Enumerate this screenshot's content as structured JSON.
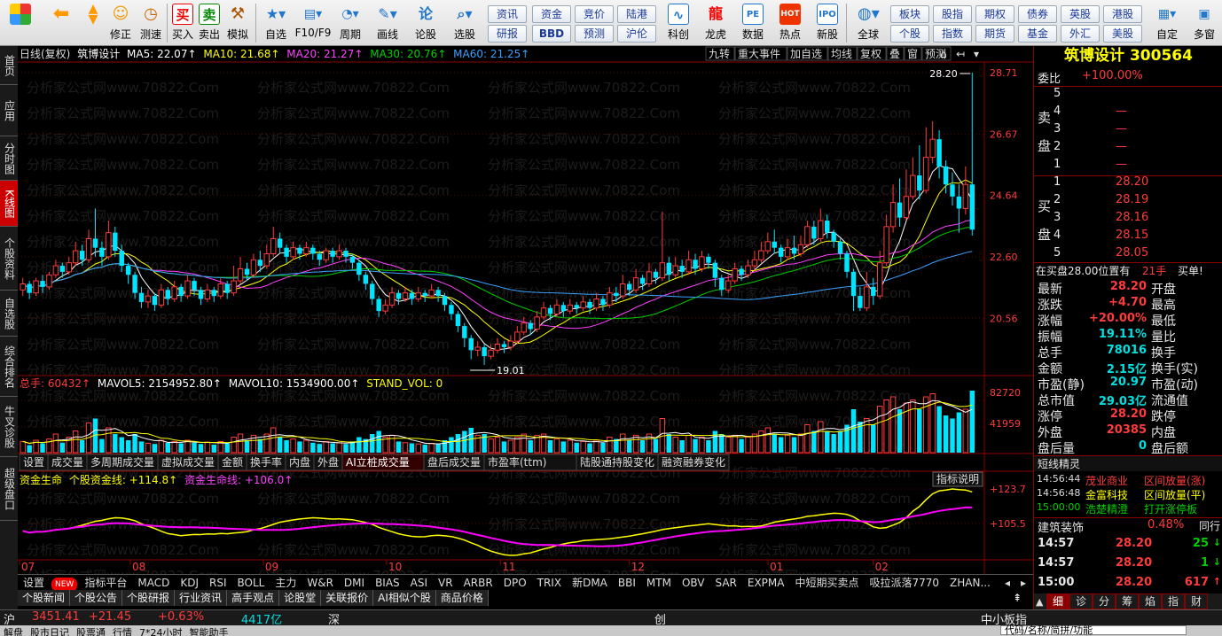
{
  "toolbar": {
    "buttons": [
      "",
      "",
      "修正",
      "测速",
      "买入",
      "卖出",
      "模拟",
      "自选",
      "F10/F9",
      "周期",
      "画线",
      "论股",
      "选股",
      "资讯",
      "资金",
      "竞价",
      "陆港",
      "研报",
      "BBD",
      "预测",
      "沪伦",
      "科创",
      "龙虎",
      "数据",
      "热点",
      "新股",
      "全球",
      "板块",
      "个股",
      "股指",
      "期权",
      "期货",
      "债券",
      "基金",
      "英股",
      "外汇",
      "港股",
      "美股",
      "自定",
      "多窗"
    ],
    "icon_names": [
      "window-icon",
      "back-icon",
      "up-down-icon",
      "smile-icon",
      "clock-icon",
      "buy-icon",
      "sell-icon",
      "hammer-icon",
      "star-icon",
      "f10-icon",
      "period-icon",
      "pen-icon",
      "chat-icon",
      "search-chart-icon",
      "globe-icon",
      "kechuang-icon",
      "dragon-icon",
      "pe-icon",
      "hot-icon",
      "ipo-icon"
    ]
  },
  "sidebar": [
    "首页",
    "应用",
    "分时图",
    "K线图",
    "个股资料",
    "自选股",
    "综合排名",
    "牛叉诊股",
    "超级盘口"
  ],
  "chart": {
    "header": {
      "title": "日线(复权)",
      "name": "筑博设计",
      "ma5": "MA5: 22.07↑",
      "ma10": "MA10: 21.68↑",
      "ma20": "MA20: 21.27↑",
      "ma30": "MA30: 20.76↑",
      "ma60": "MA60: 21.25↑",
      "right_buttons": [
        "九转",
        "重大事件",
        "加自选",
        "均线",
        "复权",
        "叠",
        "窗",
        "预测"
      ]
    },
    "y_labels": [
      "28.71",
      "26.67",
      "24.64",
      "22.60",
      "20.56"
    ],
    "high_label": "28.20",
    "low_label": "19.01",
    "watermark": "分析家公式网www.70822.Com",
    "vol_header": {
      "a": "总手: 60432↑",
      "b": "MAVOL5: 2154952.80↑",
      "c": "MAVOL10: 1534900.00↑",
      "d": "STAND_VOL: 0"
    },
    "vol_labels": [
      "82720",
      "41959"
    ],
    "vol_tabs": [
      "设置",
      "成交量",
      "多周期成交量",
      "虚拟成交量",
      "金额",
      "换手率",
      "内盘",
      "外盘",
      "AI立桩成交量",
      "盘后成交量",
      "市盈率(ttm)",
      "陆股通持股变化",
      "融资融券变化"
    ],
    "ind_header": {
      "a": "资金生命",
      "b": "个股资金线: +114.8↑",
      "c": "资金生命线: +106.0↑"
    },
    "ind_btn": "指标说明",
    "ind_labels": [
      "+123.7",
      "+105.5"
    ],
    "months": [
      "07",
      "08",
      "09",
      "10",
      "11",
      "12",
      "01",
      "02"
    ]
  },
  "chart_data": {
    "type": "candlestick",
    "candles": [
      [
        21.5,
        21.7,
        21.3,
        21.9
      ],
      [
        21.7,
        21.4,
        21.2,
        21.8
      ],
      [
        21.4,
        21.8,
        21.3,
        21.9
      ],
      [
        21.8,
        21.6,
        21.4,
        22.0
      ],
      [
        21.6,
        22.0,
        21.5,
        22.1
      ],
      [
        22.0,
        22.3,
        21.9,
        22.5
      ],
      [
        22.3,
        22.1,
        21.9,
        22.4
      ],
      [
        22.1,
        22.4,
        22.0,
        22.6
      ],
      [
        22.4,
        22.8,
        22.3,
        23.1
      ],
      [
        22.8,
        22.5,
        22.3,
        23.0
      ],
      [
        22.5,
        23.2,
        22.4,
        23.5
      ],
      [
        23.2,
        22.9,
        22.6,
        24.2
      ],
      [
        22.9,
        22.6,
        22.3,
        23.1
      ],
      [
        22.6,
        23.4,
        22.5,
        23.8
      ],
      [
        23.4,
        22.8,
        22.6,
        23.6
      ],
      [
        22.8,
        22.3,
        22.1,
        23.0
      ],
      [
        22.3,
        22.0,
        21.7,
        22.4
      ],
      [
        22.0,
        21.4,
        21.2,
        22.1
      ],
      [
        21.4,
        21.1,
        20.9,
        21.6
      ],
      [
        21.1,
        21.3,
        20.9,
        21.5
      ],
      [
        21.3,
        21.0,
        20.8,
        21.4
      ],
      [
        21.0,
        21.5,
        20.9,
        21.7
      ],
      [
        21.5,
        21.2,
        21.0,
        21.6
      ],
      [
        21.2,
        21.6,
        21.1,
        21.8
      ],
      [
        21.6,
        21.3,
        21.1,
        21.7
      ],
      [
        21.3,
        21.8,
        21.2,
        22.0
      ],
      [
        21.8,
        21.5,
        21.3,
        21.9
      ],
      [
        21.5,
        21.2,
        21.0,
        21.6
      ],
      [
        21.2,
        21.5,
        21.1,
        21.7
      ],
      [
        21.5,
        21.3,
        21.1,
        21.6
      ],
      [
        21.3,
        21.7,
        21.2,
        21.9
      ],
      [
        21.7,
        21.4,
        21.2,
        21.8
      ],
      [
        21.4,
        21.8,
        21.3,
        22.3
      ],
      [
        21.8,
        22.2,
        21.7,
        22.6
      ],
      [
        22.2,
        22.0,
        21.8,
        22.4
      ],
      [
        22.0,
        22.5,
        21.9,
        22.7
      ],
      [
        22.5,
        22.3,
        22.1,
        22.8
      ],
      [
        22.3,
        22.7,
        22.2,
        23.0
      ],
      [
        22.7,
        23.2,
        22.6,
        23.6
      ],
      [
        23.2,
        22.9,
        22.7,
        23.4
      ],
      [
        22.9,
        22.6,
        22.4,
        23.0
      ],
      [
        22.6,
        22.9,
        22.5,
        23.1
      ],
      [
        22.9,
        22.7,
        22.5,
        23.0
      ],
      [
        22.7,
        22.9,
        22.6,
        23.1
      ],
      [
        22.9,
        22.7,
        22.5,
        23.0
      ],
      [
        22.7,
        22.5,
        22.3,
        22.8
      ],
      [
        22.5,
        22.8,
        22.4,
        22.9
      ],
      [
        22.8,
        22.6,
        22.4,
        22.9
      ],
      [
        22.6,
        22.8,
        22.5,
        23.0
      ],
      [
        22.8,
        22.6,
        22.4,
        22.9
      ],
      [
        22.6,
        22.4,
        22.2,
        22.7
      ],
      [
        22.4,
        22.0,
        21.8,
        22.5
      ],
      [
        22.0,
        21.7,
        21.5,
        22.1
      ],
      [
        21.7,
        21.2,
        21.0,
        21.8
      ],
      [
        21.2,
        20.8,
        20.6,
        21.3
      ],
      [
        20.8,
        21.0,
        20.7,
        21.2
      ],
      [
        21.0,
        21.4,
        20.9,
        21.6
      ],
      [
        21.4,
        21.2,
        21.0,
        21.5
      ],
      [
        21.2,
        21.4,
        21.1,
        21.6
      ],
      [
        21.4,
        21.2,
        21.0,
        21.5
      ],
      [
        21.2,
        21.4,
        21.1,
        21.6
      ],
      [
        21.4,
        21.3,
        21.1,
        21.5
      ],
      [
        21.3,
        21.5,
        21.2,
        21.7
      ],
      [
        21.5,
        21.3,
        21.1,
        21.6
      ],
      [
        21.3,
        21.0,
        20.8,
        21.4
      ],
      [
        21.0,
        20.7,
        20.5,
        21.1
      ],
      [
        20.7,
        20.3,
        20.1,
        20.8
      ],
      [
        20.3,
        19.9,
        19.6,
        20.4
      ],
      [
        19.9,
        19.5,
        19.2,
        20.0
      ],
      [
        19.5,
        19.6,
        19.3,
        19.8
      ],
      [
        19.6,
        19.3,
        19.01,
        19.7
      ],
      [
        19.3,
        19.5,
        19.2,
        19.7
      ],
      [
        19.5,
        19.7,
        19.4,
        19.9
      ],
      [
        19.7,
        19.6,
        19.4,
        19.8
      ],
      [
        19.6,
        19.8,
        19.5,
        20.0
      ],
      [
        19.8,
        20.1,
        19.7,
        20.3
      ],
      [
        20.1,
        20.4,
        20.0,
        20.6
      ],
      [
        20.4,
        20.2,
        20.0,
        20.5
      ],
      [
        20.2,
        20.6,
        20.1,
        20.8
      ],
      [
        20.6,
        20.9,
        20.5,
        21.1
      ],
      [
        20.9,
        20.7,
        20.5,
        21.0
      ],
      [
        20.7,
        21.0,
        20.6,
        21.2
      ],
      [
        21.0,
        20.8,
        20.6,
        21.1
      ],
      [
        20.8,
        21.0,
        20.7,
        21.2
      ],
      [
        21.0,
        20.9,
        20.7,
        21.1
      ],
      [
        20.9,
        21.1,
        20.8,
        21.3
      ],
      [
        21.1,
        20.9,
        20.7,
        21.2
      ],
      [
        20.9,
        21.2,
        20.8,
        21.4
      ],
      [
        21.2,
        21.0,
        20.8,
        21.3
      ],
      [
        21.0,
        21.4,
        20.9,
        21.6
      ],
      [
        21.4,
        21.3,
        21.1,
        21.6
      ],
      [
        21.3,
        21.7,
        21.2,
        22.0
      ],
      [
        21.7,
        21.5,
        21.3,
        21.8
      ],
      [
        21.5,
        21.9,
        21.4,
        22.2
      ],
      [
        21.9,
        21.7,
        21.5,
        22.0
      ],
      [
        21.7,
        22.1,
        21.6,
        22.4
      ],
      [
        22.1,
        21.9,
        21.7,
        22.2
      ],
      [
        21.9,
        22.4,
        21.8,
        24.1
      ],
      [
        22.4,
        22.0,
        21.8,
        22.6
      ],
      [
        22.0,
        22.3,
        21.9,
        22.6
      ],
      [
        22.3,
        22.1,
        21.9,
        22.5
      ],
      [
        22.1,
        22.5,
        22.0,
        22.8
      ],
      [
        22.5,
        22.2,
        22.0,
        22.7
      ],
      [
        22.2,
        22.6,
        22.1,
        22.8
      ],
      [
        22.6,
        22.4,
        22.2,
        22.7
      ],
      [
        22.4,
        21.9,
        21.6,
        22.5
      ],
      [
        21.9,
        21.5,
        21.3,
        22.0
      ],
      [
        21.5,
        21.8,
        21.4,
        22.0
      ],
      [
        21.8,
        22.2,
        21.7,
        22.4
      ],
      [
        22.2,
        22.0,
        21.8,
        22.3
      ],
      [
        22.0,
        22.3,
        21.9,
        22.5
      ],
      [
        22.3,
        22.5,
        22.1,
        22.8
      ],
      [
        22.5,
        22.8,
        22.4,
        23.1
      ],
      [
        22.8,
        23.1,
        22.7,
        23.4
      ],
      [
        23.1,
        22.9,
        22.7,
        23.5
      ],
      [
        22.9,
        22.6,
        22.4,
        23.0
      ],
      [
        22.6,
        22.9,
        22.5,
        23.2
      ],
      [
        22.9,
        22.7,
        22.5,
        23.3
      ],
      [
        22.7,
        23.0,
        22.6,
        23.3
      ],
      [
        23.0,
        23.6,
        22.9,
        23.8
      ],
      [
        23.6,
        23.2,
        23.0,
        23.8
      ],
      [
        23.2,
        23.8,
        23.1,
        24.2
      ],
      [
        23.8,
        23.4,
        23.2,
        24.0
      ],
      [
        23.4,
        23.1,
        22.9,
        23.5
      ],
      [
        23.1,
        22.7,
        22.5,
        23.2
      ],
      [
        22.7,
        22.1,
        21.9,
        22.8
      ],
      [
        22.1,
        21.3,
        20.8,
        22.2
      ],
      [
        21.3,
        20.9,
        20.8,
        21.6
      ],
      [
        20.9,
        21.6,
        20.8,
        22.1
      ],
      [
        21.6,
        21.3,
        21.0,
        21.9
      ],
      [
        21.3,
        22.4,
        21.2,
        22.8
      ],
      [
        22.4,
        23.6,
        22.3,
        24.0
      ],
      [
        23.6,
        24.4,
        23.4,
        25.0
      ],
      [
        24.4,
        23.9,
        23.6,
        25.2
      ],
      [
        23.9,
        24.6,
        23.8,
        25.5
      ],
      [
        24.6,
        25.3,
        24.5,
        25.9
      ],
      [
        25.3,
        24.8,
        24.5,
        26.3
      ],
      [
        24.8,
        25.9,
        24.7,
        26.9
      ],
      [
        25.9,
        26.5,
        25.7,
        27.1
      ],
      [
        26.5,
        25.6,
        25.2,
        26.8
      ],
      [
        25.6,
        25.0,
        24.7,
        25.8
      ],
      [
        25.0,
        24.6,
        24.3,
        25.4
      ],
      [
        24.6,
        24.2,
        23.4,
        25.0
      ],
      [
        24.2,
        25.0,
        24.0,
        25.6
      ],
      [
        25.0,
        23.5,
        23.3,
        28.71
      ]
    ],
    "y_range": [
      19.01,
      28.71
    ],
    "volumes": [
      0.18,
      0.12,
      0.2,
      0.15,
      0.22,
      0.3,
      0.16,
      0.25,
      0.35,
      0.2,
      0.48,
      0.55,
      0.22,
      0.4,
      0.3,
      0.25,
      0.2,
      0.3,
      0.18,
      0.15,
      0.14,
      0.2,
      0.16,
      0.18,
      0.15,
      0.2,
      0.16,
      0.14,
      0.17,
      0.13,
      0.18,
      0.15,
      0.25,
      0.3,
      0.2,
      0.28,
      0.22,
      0.3,
      0.4,
      0.25,
      0.2,
      0.22,
      0.18,
      0.2,
      0.16,
      0.14,
      0.18,
      0.15,
      0.16,
      0.14,
      0.18,
      0.25,
      0.22,
      0.3,
      0.35,
      0.25,
      0.28,
      0.18,
      0.16,
      0.15,
      0.14,
      0.13,
      0.15,
      0.14,
      0.2,
      0.25,
      0.3,
      0.35,
      0.4,
      0.28,
      0.3,
      0.22,
      0.25,
      0.18,
      0.2,
      0.25,
      0.3,
      0.2,
      0.28,
      0.3,
      0.2,
      0.22,
      0.18,
      0.2,
      0.16,
      0.18,
      0.15,
      0.2,
      0.16,
      0.25,
      0.22,
      0.3,
      0.2,
      0.28,
      0.2,
      0.3,
      0.22,
      0.55,
      0.3,
      0.25,
      0.2,
      0.28,
      0.22,
      0.25,
      0.2,
      0.35,
      0.3,
      0.25,
      0.28,
      0.22,
      0.25,
      0.3,
      0.35,
      0.4,
      0.3,
      0.25,
      0.28,
      0.25,
      0.3,
      0.45,
      0.35,
      0.5,
      0.35,
      0.3,
      0.35,
      0.45,
      0.7,
      0.5,
      0.55,
      0.45,
      0.75,
      0.85,
      0.9,
      0.7,
      0.8,
      0.85,
      0.7,
      0.9,
      0.95,
      0.75,
      0.6,
      0.55,
      0.65,
      0.7,
      1.0
    ]
  },
  "right_panel": {
    "stock_name": "筑博设计",
    "stock_code": "300564",
    "weibi_label": "委比",
    "weibi_value": "+100.00%",
    "sell_label_1": "卖",
    "sell_label_2": "盘",
    "buy_label_1": "买",
    "buy_label_2": "盘",
    "sell": [
      {
        "n": "5",
        "p": "",
        "v": ""
      },
      {
        "n": "4",
        "p": "—",
        "v": ""
      },
      {
        "n": "3",
        "p": "—",
        "v": ""
      },
      {
        "n": "2",
        "p": "—",
        "v": ""
      },
      {
        "n": "1",
        "p": "—",
        "v": ""
      }
    ],
    "buy": [
      {
        "n": "1",
        "p": "28.20",
        "v": ""
      },
      {
        "n": "2",
        "p": "28.19",
        "v": ""
      },
      {
        "n": "3",
        "p": "28.16",
        "v": ""
      },
      {
        "n": "4",
        "p": "28.15",
        "v": ""
      },
      {
        "n": "5",
        "p": "28.05",
        "v": ""
      }
    ],
    "zaimai": "在买盘28.00位置有",
    "zaimai_vol": "21手",
    "zaimai_side": "买单!",
    "stats": [
      {
        "l": "最新",
        "v": "28.20",
        "r": "开盘"
      },
      {
        "l": "涨跌",
        "v": "+4.70",
        "r": "最高"
      },
      {
        "l": "涨幅",
        "v": "+20.00%",
        "r": "最低"
      },
      {
        "l": "振幅",
        "v": "19.11%",
        "r": "量比"
      },
      {
        "l": "总手",
        "v": "78016",
        "r": "换手"
      },
      {
        "l": "金额",
        "v": "2.15亿",
        "r": "换手(实)"
      },
      {
        "l": "市盈(静)",
        "v": "20.97",
        "r": "市盈(动)"
      },
      {
        "l": "总市值",
        "v": "29.03亿",
        "r": "流通值"
      },
      {
        "l": "涨停",
        "v": "28.20",
        "r": "跌停"
      },
      {
        "l": "外盘",
        "v": "20385",
        "r": "内盘"
      },
      {
        "l": "盘后量",
        "v": "0",
        "r": "盘后额"
      }
    ],
    "elf_title": "短线精灵",
    "elf": [
      {
        "t": "14:56:44",
        "n": "茂业商业",
        "e": "区间放量(涨)"
      },
      {
        "t": "14:56:48",
        "n": "金富科技",
        "e": "区间放量(平)"
      },
      {
        "t": "15:00:00",
        "n": "浩楚精澄",
        "e": "打开涨停板"
      }
    ],
    "sector_name": "建筑装饰",
    "sector_pct": "0.48%",
    "sector_tab": "同行",
    "ticks": [
      {
        "t": "14:57",
        "p": "28.20",
        "v": "25"
      },
      {
        "t": "14:57",
        "p": "28.20",
        "v": "1"
      },
      {
        "t": "15:00",
        "p": "28.20",
        "v": "617"
      }
    ],
    "bottom_tabs": [
      "细",
      "诊",
      "分",
      "筹",
      "焰",
      "指",
      "财"
    ]
  },
  "indicator_bar": [
    "设置",
    "NEW",
    "指标平台",
    "MACD",
    "KDJ",
    "RSI",
    "BOLL",
    "主力",
    "W&R",
    "DMI",
    "BIAS",
    "ASI",
    "VR",
    "ARBR",
    "DPO",
    "TRIX",
    "新DMA",
    "BBI",
    "MTM",
    "OBV",
    "SAR",
    "EXPMA",
    "中短期买卖点",
    "吸拉派落7770",
    "ZHAN..."
  ],
  "lower_tabs": [
    "个股新闻",
    "个股公告",
    "个股研报",
    "行业资讯",
    "高手观点",
    "论股堂",
    "关联报价",
    "AI相似个股",
    "商品价格"
  ],
  "status": {
    "sh": "沪",
    "sh_idx": "3451.41",
    "sh_chg": "+21.45",
    "sh_pct": "+0.63%",
    "sh_amt": "4417亿",
    "sz": "深",
    "cy": "创",
    "zxb": "中小板指"
  },
  "status2": [
    "解盘",
    "股市日记",
    "股票通",
    "行情",
    "7*24小时",
    "智能助手",
    "代码/名称/简拼/功能"
  ],
  "colors": {
    "up": "#ff3b3b",
    "down": "#00e5ff",
    "ma5": "#ffffff",
    "ma10": "#ffff00",
    "ma20": "#ff40ff",
    "ma30": "#00d000",
    "ma60": "#3aa0ff",
    "fund": "#ffff00",
    "life": "#ff00ff",
    "red_line": "#8b0000"
  }
}
